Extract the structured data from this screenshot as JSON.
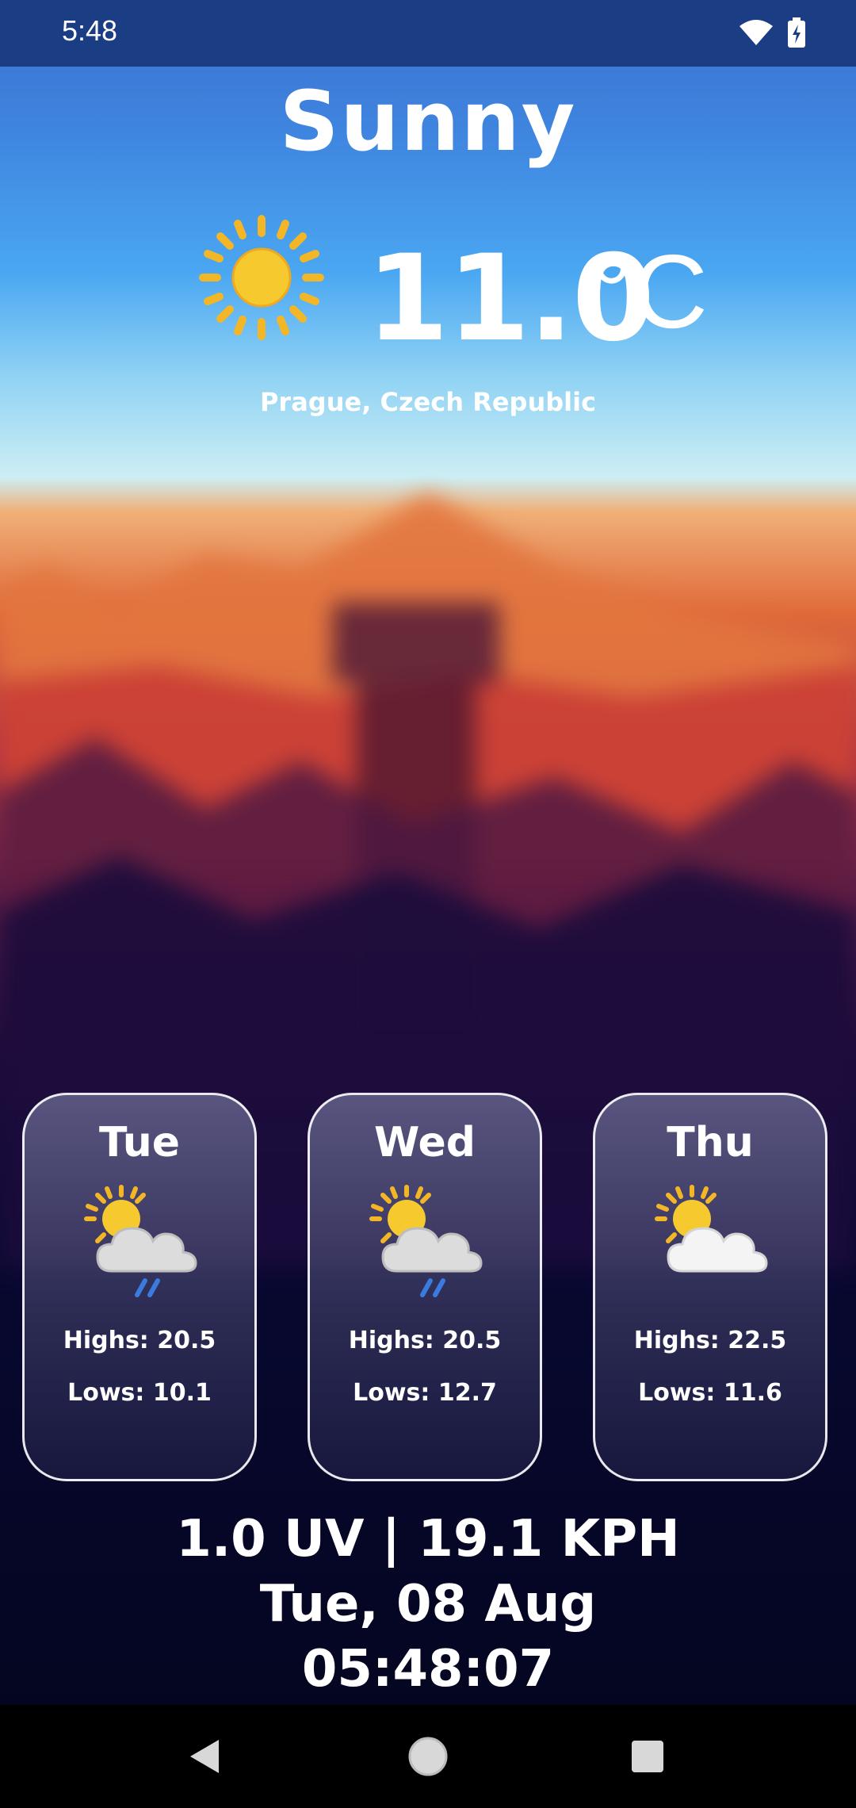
{
  "status_bar": {
    "time": "5:48",
    "wifi_icon": "wifi-icon",
    "battery_icon": "battery-charging-icon"
  },
  "current": {
    "condition": "Sunny",
    "icon": "sun-icon",
    "temperature": "11.0",
    "unit": "°C",
    "location": "Prague, Czech Republic"
  },
  "forecast": [
    {
      "day": "Tue",
      "icon": "sun-cloud-rain-icon",
      "highs": "Highs: 20.5",
      "lows": "Lows: 10.1"
    },
    {
      "day": "Wed",
      "icon": "sun-cloud-rain-icon",
      "highs": "Highs: 20.5",
      "lows": "Lows: 12.7"
    },
    {
      "day": "Thu",
      "icon": "sun-cloud-icon",
      "highs": "Highs: 22.5",
      "lows": "Lows: 11.6"
    }
  ],
  "footer": {
    "uv_wind": "1.0 UV | 19.1 KPH",
    "date": "Tue, 08 Aug",
    "clock": "05:48:07"
  },
  "nav": {
    "back_icon": "back-icon",
    "home_icon": "home-icon",
    "recents_icon": "recents-icon"
  },
  "colors": {
    "status_bar": "#1a3d83",
    "sun": "#f5c42c",
    "rain": "#3a7be0"
  }
}
